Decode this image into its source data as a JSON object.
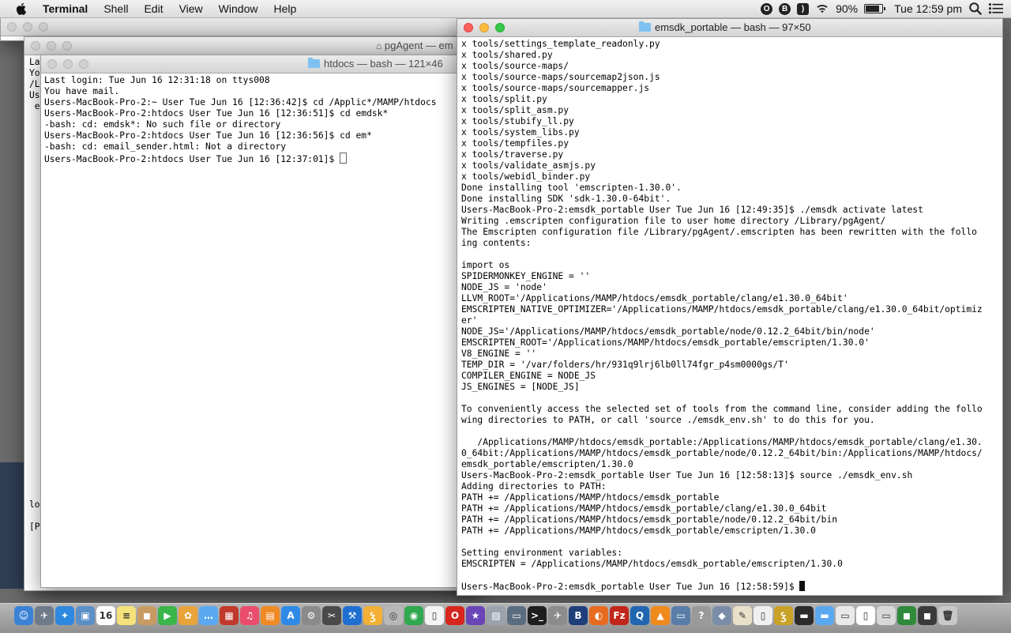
{
  "menubar": {
    "app_name": "Terminal",
    "items": [
      "Shell",
      "Edit",
      "View",
      "Window",
      "Help"
    ],
    "battery": "90%",
    "clock": "Tue 12:59 pm"
  },
  "windows": {
    "pgagent": {
      "title": "pgAgent — em",
      "lines": [
        "Las",
        "You",
        "/L",
        "Use",
        " em",
        "",
        "",
        "",
        "",
        "",
        "",
        "",
        "",
        "",
        "",
        "",
        "",
        "",
        "",
        "",
        "",
        "",
        "",
        "",
        "",
        "",
        "",
        "",
        "",
        "",
        "",
        "",
        "",
        "",
        "",
        "",
        "",
        "",
        "",
        "",
        "log",
        "",
        "[P"
      ]
    },
    "htdocs": {
      "title": "htdocs — bash — 121×46",
      "lines": [
        "Last login: Tue Jun 16 12:31:18 on ttys008",
        "You have mail.",
        "Users-MacBook-Pro-2:~ User Tue Jun 16 [12:36:42]$ cd /Applic*/MAMP/htdocs",
        "Users-MacBook-Pro-2:htdocs User Tue Jun 16 [12:36:51]$ cd emdsk*",
        "-bash: cd: emdsk*: No such file or directory",
        "Users-MacBook-Pro-2:htdocs User Tue Jun 16 [12:36:56]$ cd em*",
        "-bash: cd: email_sender.html: Not a directory",
        "Users-MacBook-Pro-2:htdocs User Tue Jun 16 [12:37:01]$ "
      ]
    },
    "emsdk": {
      "title": "emsdk_portable — bash — 97×50",
      "lines": [
        "x tools/settings_template_readonly.py",
        "x tools/shared.py",
        "x tools/source-maps/",
        "x tools/source-maps/sourcemap2json.js",
        "x tools/source-maps/sourcemapper.js",
        "x tools/split.py",
        "x tools/split_asm.py",
        "x tools/stubify_ll.py",
        "x tools/system_libs.py",
        "x tools/tempfiles.py",
        "x tools/traverse.py",
        "x tools/validate_asmjs.py",
        "x tools/webidl_binder.py",
        "Done installing tool 'emscripten-1.30.0'.",
        "Done installing SDK 'sdk-1.30.0-64bit'.",
        "Users-MacBook-Pro-2:emsdk_portable User Tue Jun 16 [12:49:35]$ ./emsdk activate latest",
        "Writing .emscripten configuration file to user home directory /Library/pgAgent/",
        "The Emscripten configuration file /Library/pgAgent/.emscripten has been rewritten with the follo",
        "ing contents:",
        "",
        "import os",
        "SPIDERMONKEY_ENGINE = ''",
        "NODE_JS = 'node'",
        "LLVM_ROOT='/Applications/MAMP/htdocs/emsdk_portable/clang/e1.30.0_64bit'",
        "EMSCRIPTEN_NATIVE_OPTIMIZER='/Applications/MAMP/htdocs/emsdk_portable/clang/e1.30.0_64bit/optimiz",
        "er'",
        "NODE_JS='/Applications/MAMP/htdocs/emsdk_portable/node/0.12.2_64bit/bin/node'",
        "EMSCRIPTEN_ROOT='/Applications/MAMP/htdocs/emsdk_portable/emscripten/1.30.0'",
        "V8_ENGINE = ''",
        "TEMP_DIR = '/var/folders/hr/931q9lrj6lb0ll74fgr_p4sm0000gs/T'",
        "COMPILER_ENGINE = NODE_JS",
        "JS_ENGINES = [NODE_JS]",
        "",
        "To conveniently access the selected set of tools from the command line, consider adding the follo",
        "wing directories to PATH, or call 'source ./emsdk_env.sh' to do this for you.",
        "",
        "   /Applications/MAMP/htdocs/emsdk_portable:/Applications/MAMP/htdocs/emsdk_portable/clang/e1.30.",
        "0_64bit:/Applications/MAMP/htdocs/emsdk_portable/node/0.12.2_64bit/bin:/Applications/MAMP/htdocs/",
        "emsdk_portable/emscripten/1.30.0",
        "Users-MacBook-Pro-2:emsdk_portable User Tue Jun 16 [12:58:13]$ source ./emsdk_env.sh",
        "Adding directories to PATH:",
        "PATH += /Applications/MAMP/htdocs/emsdk_portable",
        "PATH += /Applications/MAMP/htdocs/emsdk_portable/clang/e1.30.0_64bit",
        "PATH += /Applications/MAMP/htdocs/emsdk_portable/node/0.12.2_64bit/bin",
        "PATH += /Applications/MAMP/htdocs/emsdk_portable/emscripten/1.30.0",
        "",
        "Setting environment variables:",
        "EMSCRIPTEN = /Applications/MAMP/htdocs/emsdk_portable/emscripten/1.30.0",
        "",
        "Users-MacBook-Pro-2:emsdk_portable User Tue Jun 16 [12:58:59]$ "
      ]
    }
  },
  "dock": {
    "items": [
      {
        "name": "finder-icon",
        "color": "#3b82d6",
        "glyph": "☺"
      },
      {
        "name": "launchpad-icon",
        "color": "#6f7b8a",
        "glyph": "✈"
      },
      {
        "name": "safari-icon",
        "color": "#2f88e0",
        "glyph": "✦"
      },
      {
        "name": "preview-icon",
        "color": "#5a8fc7",
        "glyph": "▣"
      },
      {
        "name": "calendar-icon",
        "color": "#ffffff",
        "glyph": "16"
      },
      {
        "name": "notes-icon",
        "color": "#f5e27a",
        "glyph": "≡"
      },
      {
        "name": "contacts-icon",
        "color": "#c89b62",
        "glyph": "◼"
      },
      {
        "name": "facetime-icon",
        "color": "#3ab54a",
        "glyph": "▶"
      },
      {
        "name": "photos-icon",
        "color": "#e8a33a",
        "glyph": "✿"
      },
      {
        "name": "messages-icon",
        "color": "#5aa8f0",
        "glyph": "…"
      },
      {
        "name": "photobooth-icon",
        "color": "#c0392b",
        "glyph": "▦"
      },
      {
        "name": "itunes-icon",
        "color": "#e94d6b",
        "glyph": "♫"
      },
      {
        "name": "ibooks-icon",
        "color": "#f08a24",
        "glyph": "▤"
      },
      {
        "name": "appstore-icon",
        "color": "#2f8ae6",
        "glyph": "A"
      },
      {
        "name": "system-preferences-icon",
        "color": "#8a8a8a",
        "glyph": "⚙"
      },
      {
        "name": "utilities-icon",
        "color": "#4a4a4a",
        "glyph": "✂"
      },
      {
        "name": "xcode-icon",
        "color": "#1f6fd1",
        "glyph": "⚒"
      },
      {
        "name": "filezilla-app-icon",
        "color": "#f2b134",
        "glyph": "Ꝣ"
      },
      {
        "name": "disk-icon",
        "color": "#b8b8b8",
        "glyph": "◎"
      },
      {
        "name": "chrome-icon",
        "color": "#2fa84f",
        "glyph": "◉"
      },
      {
        "name": "document-icon",
        "color": "#f4f4f4",
        "glyph": "▯"
      },
      {
        "name": "opera-icon",
        "color": "#d7261e",
        "glyph": "O"
      },
      {
        "name": "star-icon",
        "color": "#6a45b8",
        "glyph": "★"
      },
      {
        "name": "image-capture-icon",
        "color": "#9aa3ad",
        "glyph": "▨"
      },
      {
        "name": "screenshot-icon",
        "color": "#5b6b80",
        "glyph": "▭"
      },
      {
        "name": "terminal-icon",
        "color": "#1e1e1e",
        "glyph": ">_"
      },
      {
        "name": "automator-icon",
        "color": "#8c8c8c",
        "glyph": "✈"
      },
      {
        "name": "bbedit-icon",
        "color": "#1f3f7a",
        "glyph": "B"
      },
      {
        "name": "firefox-icon",
        "color": "#e66b1f",
        "glyph": "◐"
      },
      {
        "name": "filezilla-icon",
        "color": "#c0261b",
        "glyph": "Fz"
      },
      {
        "name": "q-app-icon",
        "color": "#2166b0",
        "glyph": "Q"
      },
      {
        "name": "vlc-icon",
        "color": "#f08a1c",
        "glyph": "▲"
      },
      {
        "name": "screen-icon",
        "color": "#5a7da8",
        "glyph": "▭"
      },
      {
        "name": "help-icon",
        "color": "#9a9a9a",
        "glyph": "?"
      },
      {
        "name": "cube-icon",
        "color": "#7a8da8",
        "glyph": "◆"
      },
      {
        "name": "script-icon",
        "color": "#e8e0c8",
        "glyph": "✎"
      },
      {
        "name": "page-icon",
        "color": "#f0f0f0",
        "glyph": "▯"
      },
      {
        "name": "ftp-icon",
        "color": "#c9a227",
        "glyph": "Ꝣ"
      },
      {
        "name": "console-icon",
        "color": "#2b2b2b",
        "glyph": "▬"
      },
      {
        "name": "folder-icon",
        "color": "#5aa8f0",
        "glyph": "▬"
      },
      {
        "name": "window-icon",
        "color": "#eaeaea",
        "glyph": "▭"
      },
      {
        "name": "blank-doc-icon",
        "color": "#ffffff",
        "glyph": "▯"
      },
      {
        "name": "image-icon",
        "color": "#d8d8d8",
        "glyph": "▭"
      },
      {
        "name": "app-green-icon",
        "color": "#2f8a3b",
        "glyph": "◼"
      },
      {
        "name": "app-dark-icon",
        "color": "#3a3a3a",
        "glyph": "◼"
      },
      {
        "name": "trash-icon",
        "color": "#c8c8c8",
        "glyph": "🗑"
      }
    ]
  }
}
